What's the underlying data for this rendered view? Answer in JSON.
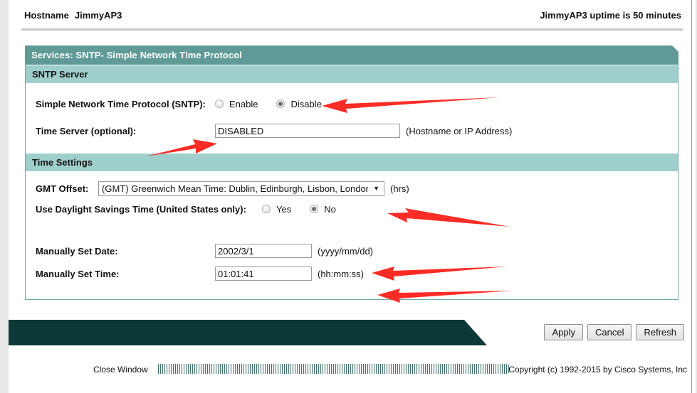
{
  "topbar": {
    "hostname_label": "Hostname",
    "hostname_value": "JimmyAP3",
    "uptime": "JimmyAP3 uptime is 50 minutes"
  },
  "panel": {
    "title": "Services: SNTP- Simple Network Time Protocol",
    "sections": [
      {
        "heading": "SNTP Server",
        "rows": [
          {
            "label": "Simple Network Time Protocol (SNTP):",
            "options": [
              {
                "label": "Enable",
                "selected": false
              },
              {
                "label": "Disable",
                "selected": true
              }
            ]
          },
          {
            "label": "Time Server (optional):",
            "value": "DISABLED",
            "hint": "(Hostname or IP Address)"
          }
        ]
      },
      {
        "heading": "Time Settings",
        "gmt_offset": {
          "label": "GMT Offset:",
          "selected": "(GMT) Greenwich Mean Time: Dublin, Edinburgh, Lisbon, London",
          "hint": "(hrs)",
          "chevron": "▼"
        },
        "daylight": {
          "label": "Use Daylight Savings Time (United States only):",
          "options": [
            {
              "label": "Yes",
              "selected": false
            },
            {
              "label": "No",
              "selected": true
            }
          ]
        },
        "manual_date": {
          "label": "Manually Set Date:",
          "value": "2002/3/1",
          "hint": "(yyyy/mm/dd)"
        },
        "manual_time": {
          "label": "Manually Set Time:",
          "value": "01:01:41",
          "hint": "(hh:mm:ss)"
        }
      }
    ]
  },
  "actions": {
    "apply": "Apply",
    "cancel": "Cancel",
    "refresh": "Refresh"
  },
  "footer": {
    "close_window": "Close Window",
    "copyright": "Copyright (c) 1992-2015 by Cisco Systems, Inc"
  },
  "colors": {
    "title_bar": "#5f9a96",
    "section_bar": "#9fcfca",
    "action_bar": "#0b3a38",
    "annotation": "#fb2c25"
  }
}
